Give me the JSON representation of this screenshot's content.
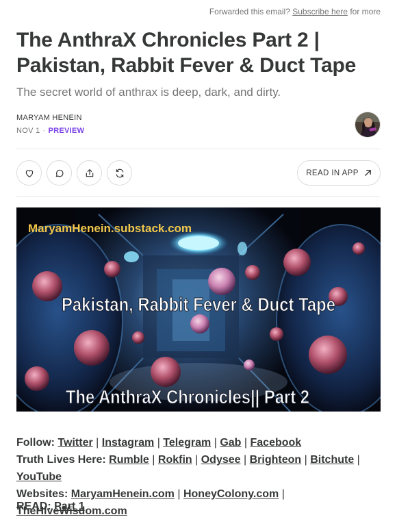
{
  "header": {
    "forward_text": "Forwarded this email?",
    "subscribe_link": "Subscribe here",
    "for_more": "for more"
  },
  "post": {
    "title": "The AnthraX Chronicles Part 2 | Pakistan, Rabbit Fever & Duct Tape",
    "subtitle": "The secret world of anthrax is deep, dark, and dirty.",
    "author": "MARYAM HENEIN",
    "date": "NOV 1",
    "separator": "·",
    "access": "PREVIEW"
  },
  "actions": {
    "like_icon": "heart-icon",
    "comment_icon": "comment-icon",
    "share_icon": "share-icon",
    "restack_icon": "restack-icon",
    "read_in_app": "READ IN APP"
  },
  "hero": {
    "site": "MaryamHenein.substack.com",
    "headline": "Pakistan, Rabbit Fever & Duct Tape",
    "series": "The AnthraX Chronicles|| Part 2"
  },
  "body": {
    "follow_label": "Follow:",
    "follow_links": [
      "Twitter",
      "Instagram",
      "Telegram",
      "Gab",
      "Facebook"
    ],
    "truth_label": "Truth Lives Here:",
    "truth_links": [
      "Rumble",
      "Rokfin",
      "Odysee",
      "Brighteon",
      "Bitchute",
      "YouTube"
    ],
    "websites_label": "Websites:",
    "websites_links": [
      "MaryamHenein.com",
      "HoneyColony.com",
      "TheHiveWisdom.com"
    ],
    "read_label": "READ:",
    "read_link": "Part 1",
    "pipe": "|"
  },
  "colors": {
    "accent": "#7a40e8",
    "text": "#363737",
    "muted": "#757575",
    "hero_site_text": "#f2c84b"
  }
}
